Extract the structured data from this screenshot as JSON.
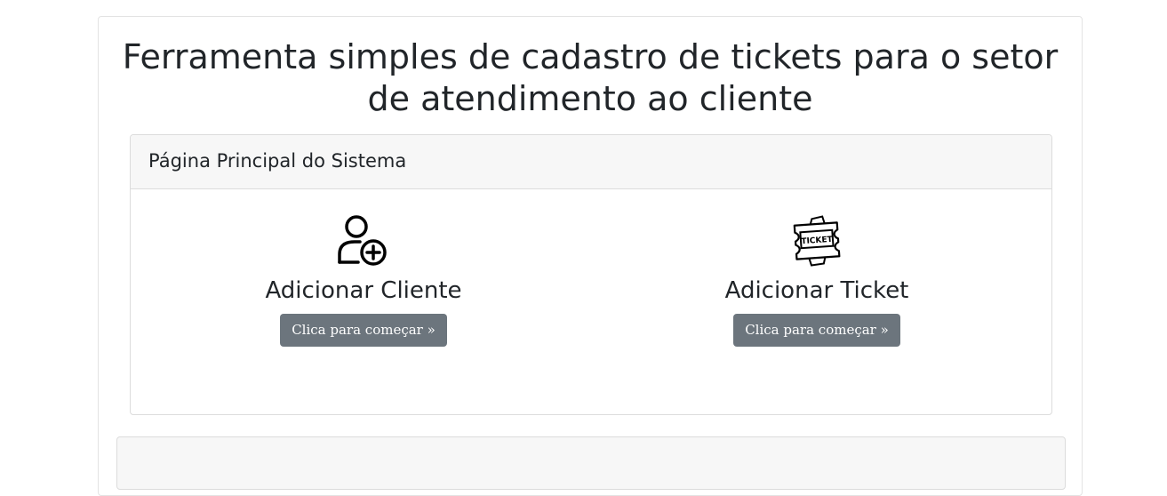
{
  "page": {
    "title": "Ferramenta simples de cadastro de tickets para o setor de atendimento ao cliente"
  },
  "panel": {
    "header": "Página Principal do Sistema",
    "actions": [
      {
        "title": "Adicionar Cliente",
        "button_label": "Clica para começar »",
        "icon": "user-plus-icon"
      },
      {
        "title": "Adicionar Ticket",
        "button_label": "Clica para começar »",
        "icon": "ticket-icon",
        "icon_text": "TICKET"
      }
    ]
  },
  "colors": {
    "button": "#6c757d",
    "header_bg": "#f7f7f7",
    "text": "#212529"
  }
}
